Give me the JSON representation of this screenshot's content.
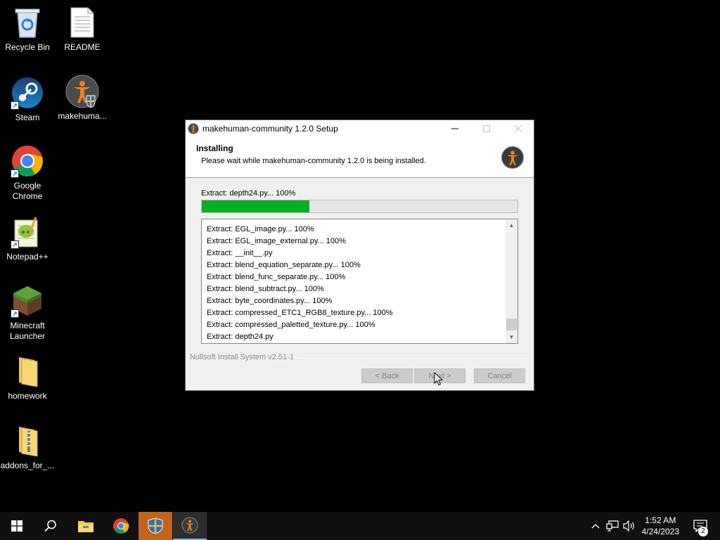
{
  "desktop": {
    "icons": [
      {
        "label": "Recycle Bin",
        "icon": "recycle-bin-icon"
      },
      {
        "label": "README",
        "icon": "text-file-icon"
      },
      {
        "label": "Steam",
        "icon": "steam-icon"
      },
      {
        "label": "makehuma...",
        "icon": "makehuman-icon"
      },
      {
        "label": "Google Chrome",
        "icon": "chrome-icon"
      },
      {
        "label": "Notepad++",
        "icon": "notepad-plus-plus-icon"
      },
      {
        "label": "Minecraft Launcher",
        "icon": "minecraft-icon"
      },
      {
        "label": "homework",
        "icon": "folder-icon"
      },
      {
        "label": "addons_for_...",
        "icon": "zip-folder-icon"
      }
    ]
  },
  "window": {
    "title": "makehuman-community 1.2.0 Setup",
    "header_title": "Installing",
    "header_subtitle": "Please wait while makehuman-community 1.2.0 is being installed.",
    "status_text": "Extract: depth24.py... 100%",
    "progress": 0.34,
    "log": [
      "Extract: EGL_image.py... 100%",
      "Extract: EGL_image_external.py... 100%",
      "Extract: __init__.py",
      "Extract: blend_equation_separate.py... 100%",
      "Extract: blend_func_separate.py... 100%",
      "Extract: blend_subtract.py... 100%",
      "Extract: byte_coordinates.py... 100%",
      "Extract: compressed_ETC1_RGB8_texture.py... 100%",
      "Extract: compressed_paletted_texture.py... 100%",
      "Extract: depth24.py"
    ],
    "branding": "Nullsoft Install System v2.51-1",
    "buttons": {
      "back": "< Back",
      "next": "Next >",
      "cancel": "Cancel"
    }
  },
  "taskbar": {
    "time": "1:52 AM",
    "date": "4/24/2023",
    "notification_count": "2"
  },
  "colors": {
    "progress_fill": "#06b025",
    "taskbar_bg": "#101010",
    "highlight": "#c0641a"
  }
}
